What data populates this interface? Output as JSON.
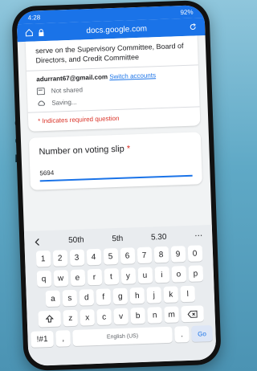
{
  "status": {
    "time": "4:28",
    "right": "92%"
  },
  "browser": {
    "url": "docs.google.com"
  },
  "form": {
    "description": "serve on the Supervisory Committee, Board of Directors, and Credit Committee",
    "email": "adurrant67@gmail.com",
    "switch_accounts": "Switch accounts",
    "not_shared": "Not shared",
    "saving": "Saving...",
    "required_note": "* Indicates required question"
  },
  "question": {
    "title": "Number on voting slip",
    "required_star": "*",
    "answer": "5694"
  },
  "keyboard": {
    "suggestions": [
      "50th",
      "5th",
      "5.30"
    ],
    "more": "⋯",
    "row_numbers": [
      "1",
      "2",
      "3",
      "4",
      "5",
      "6",
      "7",
      "8",
      "9",
      "0"
    ],
    "row1": [
      "q",
      "w",
      "e",
      "r",
      "t",
      "y",
      "u",
      "i",
      "o",
      "p"
    ],
    "row2": [
      "a",
      "s",
      "d",
      "f",
      "g",
      "h",
      "j",
      "k",
      "l"
    ],
    "row3": [
      "z",
      "x",
      "c",
      "v",
      "b",
      "n",
      "m"
    ],
    "symbols": "!#1",
    "comma": ",",
    "space_label": "English (US)",
    "period": ".",
    "go": "Go",
    "shift_icon": "shift-icon",
    "backspace_icon": "backspace-icon"
  },
  "background_text": [
    "n",
    "d",
    "e",
    "n"
  ],
  "colors": {
    "accent": "#1a73e8",
    "required": "#d93025"
  }
}
